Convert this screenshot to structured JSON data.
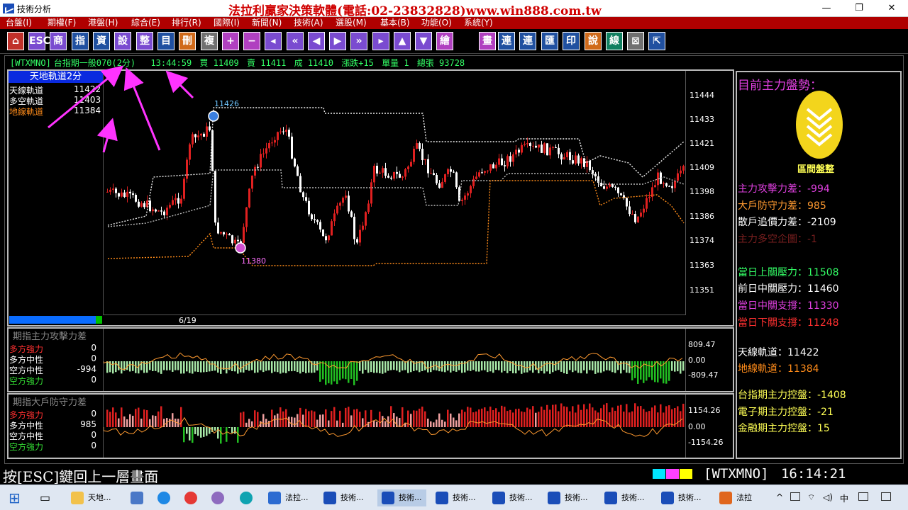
{
  "window": {
    "title": "技術分析",
    "banner": "法拉利贏家決策軟體(電話:02-23832828)www.win888.com.tw",
    "controls": [
      "—",
      "❐",
      "✕"
    ]
  },
  "menu": [
    "台盤(I)",
    "期權(F)",
    "港盤(H)",
    "綜合(E)",
    "排行(R)",
    "國際(I)",
    "新聞(N)",
    "技術(A)",
    "選股(M)",
    "基本(B)",
    "功能(O)",
    "系統(Y)"
  ],
  "toolbar": [
    "⌂",
    "ESC",
    "商",
    "指",
    "資",
    "設",
    "整",
    "目",
    "刪",
    "複",
    "+",
    "−",
    "◂",
    "«",
    "◀",
    "▶",
    "»",
    "▸",
    "▲",
    "▼",
    "繪",
    "畫",
    "連",
    "連",
    "匯",
    "印",
    "說",
    "線",
    "⊠",
    "⇱"
  ],
  "status": {
    "code": "[WTXMNO]",
    "name": "台指期一般070(2分)",
    "time": "13:44:59",
    "buy": "買 11409",
    "sell": "賣 11411",
    "deal": "成 11410",
    "change": "漲跌+15",
    "qty": "單量 1",
    "total": "總張 93728"
  },
  "price_panel": {
    "header": "天地軌道2分",
    "legend": [
      {
        "label": "天線軌道",
        "value": "11422",
        "color": "#ffffff"
      },
      {
        "label": "多空軌道",
        "value": "11403",
        "color": "#ffffff"
      },
      {
        "label": "地線軌道",
        "value": "11384",
        "color": "#ff8c1a"
      }
    ],
    "price_ticks": [
      "11444",
      "11433",
      "11421",
      "11409",
      "11398",
      "11386",
      "11374",
      "11363",
      "11351"
    ],
    "high_marker": "11426",
    "low_marker": "11380",
    "date": "6/19"
  },
  "attack_panel": {
    "title": "期指主力攻擊力差",
    "rows": [
      {
        "label": "多方強力",
        "value": "0",
        "color": "#ff3030"
      },
      {
        "label": "多方中性",
        "value": "0",
        "color": "#ffffff"
      },
      {
        "label": "空方中性",
        "value": "-994",
        "color": "#ffffff"
      },
      {
        "label": "空方強力",
        "value": "0",
        "color": "#33dd33"
      }
    ],
    "axis": [
      "809.47",
      "0.00",
      "-809.47"
    ]
  },
  "defense_panel": {
    "title": "期指大戶防守力差",
    "rows": [
      {
        "label": "多方強力",
        "value": "0",
        "color": "#ff3030"
      },
      {
        "label": "多方中性",
        "value": "985",
        "color": "#ffffff"
      },
      {
        "label": "空方中性",
        "value": "0",
        "color": "#ffffff"
      },
      {
        "label": "空方強力",
        "value": "0",
        "color": "#33dd33"
      }
    ],
    "axis": [
      "1154.26",
      "0.00",
      "-1154.26"
    ]
  },
  "right_panel": {
    "heading": "目前主力盤勢：",
    "trend": "區間盤整",
    "lines": [
      {
        "text": "主力攻擊力差：-994",
        "color": "#e040e0"
      },
      {
        "text": "大戶防守力差：985",
        "color": "#ff9a30"
      },
      {
        "text": "散戶追價力差：-2109",
        "color": "#ffffff"
      },
      {
        "text": "主力多空企圖：-1",
        "color": "#7a1f1f"
      },
      {
        "text": "當日上關壓力：11508",
        "color": "#33ff66"
      },
      {
        "text": "前日中關壓力：11460",
        "color": "#ffffff"
      },
      {
        "text": "當日中關支撐：11330",
        "color": "#e040e0"
      },
      {
        "text": "當日下關支撐：11248",
        "color": "#ff3030"
      },
      {
        "text": "天線軌道：11422",
        "color": "#ffffff"
      },
      {
        "text": "地線軌道：11384",
        "color": "#ff8c1a"
      },
      {
        "text": "台指期主力控盤：-1408",
        "color": "#ffff55"
      },
      {
        "text": "電子期主力控盤：-21",
        "color": "#ffff55"
      },
      {
        "text": "金融期主力控盤：15",
        "color": "#ffff55"
      }
    ]
  },
  "bottom": {
    "message": "按[ESC]鍵回上一層畫面",
    "code": "[WTXMNO]",
    "clock": "16:14:21"
  },
  "taskbar": {
    "items": [
      "天地...",
      "法拉...",
      "技術...",
      "技術...",
      "技術...",
      "技術...",
      "技術...",
      "技術...",
      "技術...",
      "法拉"
    ],
    "tray": [
      "^",
      "中"
    ]
  }
}
